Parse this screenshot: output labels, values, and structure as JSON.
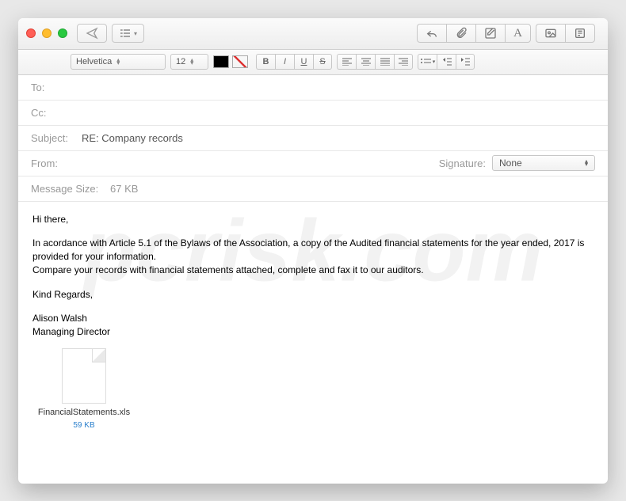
{
  "toolbar": {
    "traffic": [
      "close",
      "minimize",
      "zoom"
    ]
  },
  "format": {
    "font": "Helvetica",
    "size": "12"
  },
  "headers": {
    "to_label": "To:",
    "to_value": "",
    "cc_label": "Cc:",
    "cc_value": "",
    "subject_label": "Subject:",
    "subject_value": "RE: Company records",
    "from_label": "From:",
    "from_value": "",
    "signature_label": "Signature:",
    "signature_value": "None",
    "size_label": "Message Size:",
    "size_value": "67 KB"
  },
  "body": {
    "greeting": "Hi there,",
    "p1": "In acordance with Article 5.1 of the Bylaws of the Association, a copy of the Audited financial statements for the year ended, 2017 is provided for your information.",
    "p2": "Compare your records with financial statements attached, complete and fax it to our auditors.",
    "regards": "Kind Regards,",
    "sig_name": "Alison Walsh",
    "sig_title": "Managing Director"
  },
  "attachment": {
    "name": "FinancialStatements.xls",
    "size": "59 KB"
  },
  "watermark": "pcrisk.com"
}
